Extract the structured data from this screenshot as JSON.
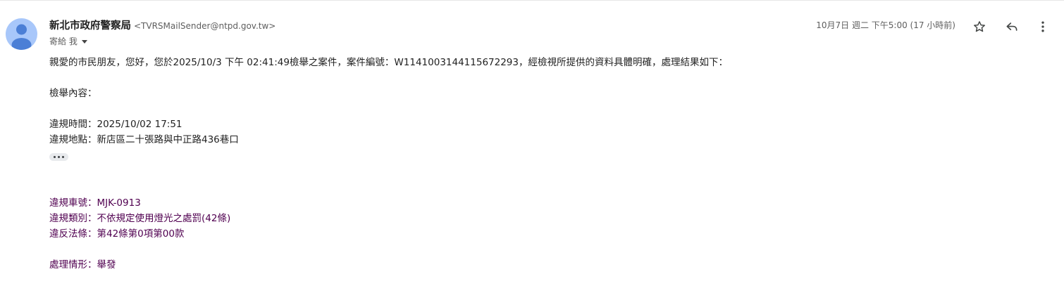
{
  "sender": {
    "name": "新北市政府警察局",
    "email": "<TVRSMailSender@ntpd.gov.tw>",
    "to_label": "寄給 我"
  },
  "date_label": "10月7日 週二 下午5:00 (17 小時前)",
  "actions": {
    "star": "star-icon",
    "reply": "reply-icon",
    "more": "more-vert-icon"
  },
  "body": {
    "intro": "親愛的市民朋友，您好，您於2025/10/3 下午 02:41:49檢舉之案件，案件編號：W1141003144115672293，經檢視所提供的資料具體明確，處理結果如下：",
    "report_heading": "檢舉內容：",
    "violation_time": "違規時間：2025/10/02 17:51",
    "violation_place": "違規地點：新店區二十張路與中正路436巷口",
    "plate": "違規車號：MJK-0913",
    "category": "違規類別：不依規定使用燈光之處罰(42條)",
    "law": "違反法條：第42條第0項第00款",
    "result": "處理情形：舉發"
  },
  "colors": {
    "avatar_bg": "#a8c7fa",
    "avatar_fg": "#4b7fd6",
    "quoted_text": "#500050"
  }
}
